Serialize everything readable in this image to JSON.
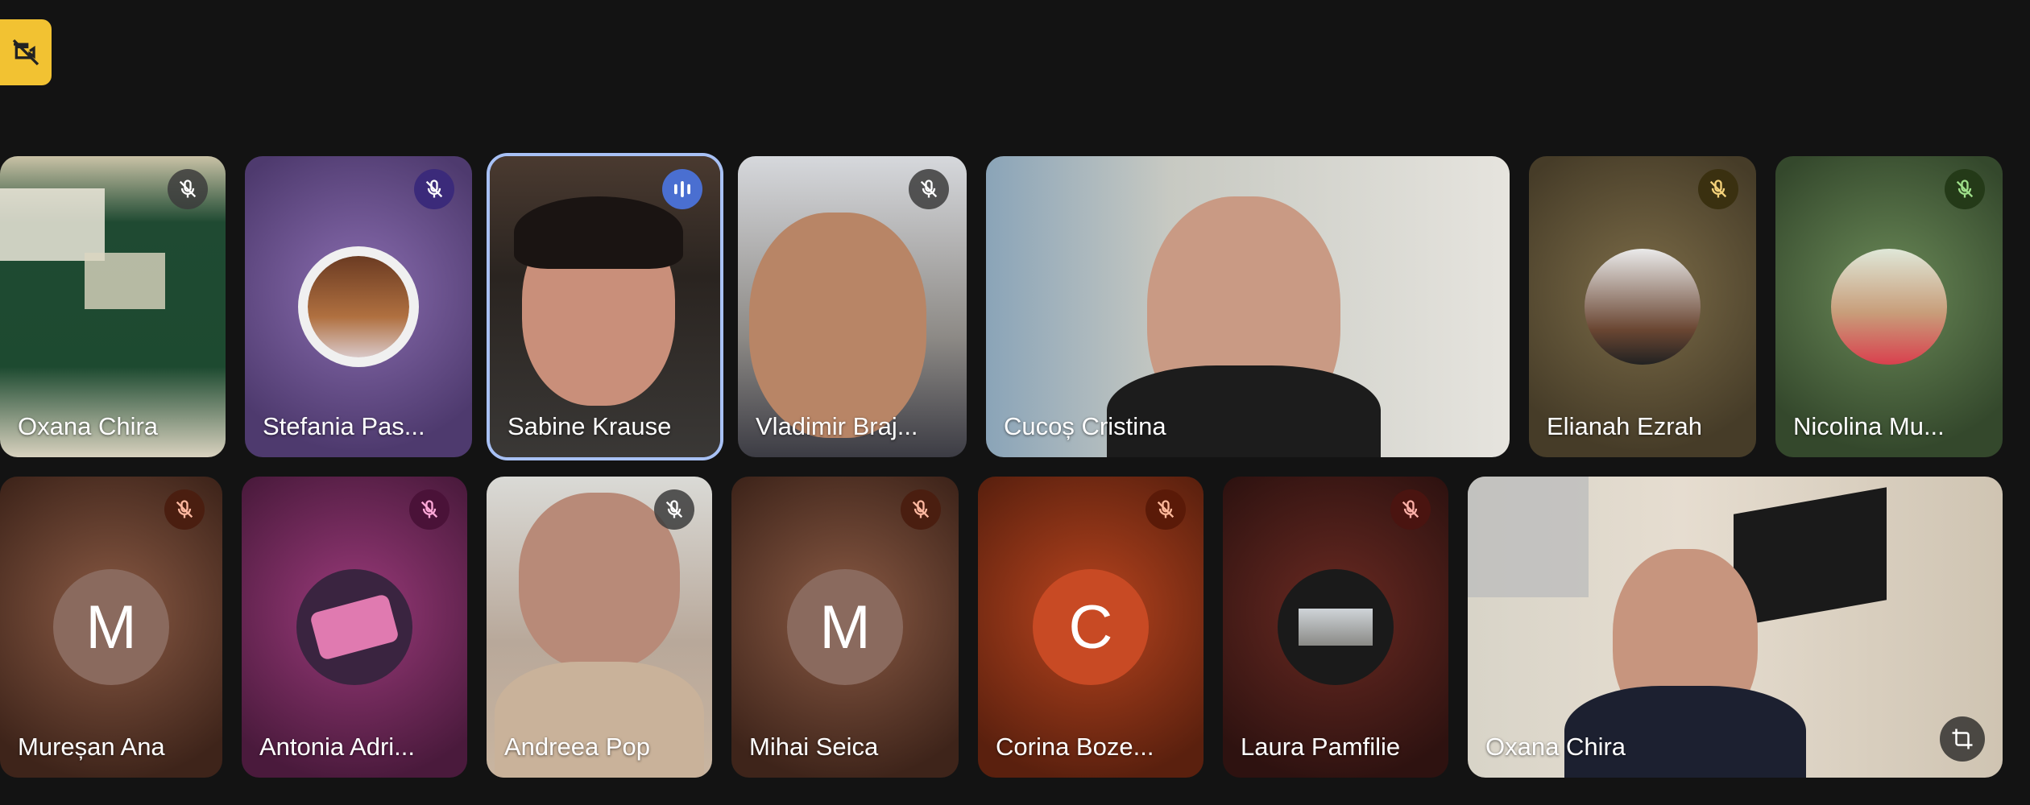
{
  "participants_row1": [
    {
      "name": "Oxana Chira"
    },
    {
      "name": "Stefania Pas..."
    },
    {
      "name": "Sabine Krause"
    },
    {
      "name": "Vladimir Braj..."
    },
    {
      "name": "Cucoș Cristina"
    },
    {
      "name": "Elianah Ezrah"
    },
    {
      "name": "Nicolina Mu..."
    }
  ],
  "participants_row2": [
    {
      "name": "Mureșan Ana",
      "avatar_letter": "M"
    },
    {
      "name": "Antonia Adri..."
    },
    {
      "name": "Andreea Pop"
    },
    {
      "name": "Mihai Seica",
      "avatar_letter": "M"
    },
    {
      "name": "Corina Boze...",
      "avatar_letter": "C"
    },
    {
      "name": "Laura Pamfilie"
    },
    {
      "name": "Oxana Chira"
    }
  ],
  "icons": {
    "top_badge": "hide-self-view-icon",
    "mic_muted": "mic-off-icon",
    "speaking": "audio-level-icon",
    "crop": "crop-icon"
  },
  "colors": {
    "background": "#131313",
    "active_speaker_border": "#a8c1f5",
    "top_badge": "#f2c232"
  }
}
